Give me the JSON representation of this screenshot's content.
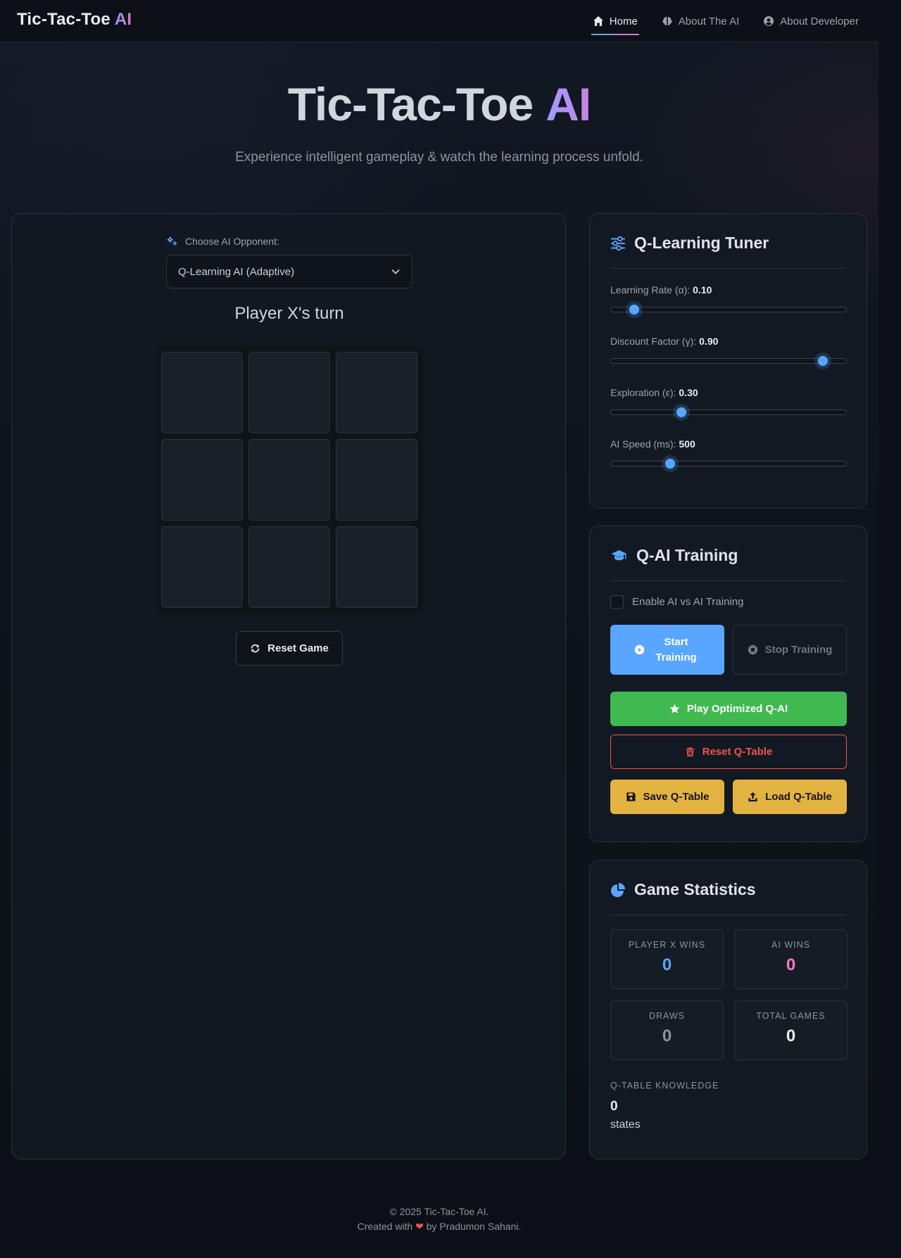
{
  "nav": {
    "brand_main": "Tic-Tac-Toe",
    "brand_accent": "AI",
    "links": [
      {
        "label": "Home",
        "icon": "home-icon",
        "active": true
      },
      {
        "label": "About The AI",
        "icon": "brain-icon",
        "active": false
      },
      {
        "label": "About Developer",
        "icon": "user-circle-icon",
        "active": false
      }
    ]
  },
  "hero": {
    "title_main": "Tic-Tac-Toe",
    "title_accent": "AI",
    "subtitle": "Experience intelligent gameplay & watch the learning process unfold."
  },
  "game": {
    "select_label": "Choose AI Opponent:",
    "select_value": "Q-Learning AI (Adaptive)",
    "turn_text": "Player X's turn",
    "board": [
      "",
      "",
      "",
      "",
      "",
      "",
      "",
      "",
      ""
    ],
    "reset_label": "Reset Game"
  },
  "tuner": {
    "title": "Q-Learning Tuner",
    "sliders": [
      {
        "label": "Learning Rate (α):",
        "value": "0.10",
        "fraction": 0.1
      },
      {
        "label": "Discount Factor (γ):",
        "value": "0.90",
        "fraction": 0.9
      },
      {
        "label": "Exploration (ε):",
        "value": "0.30",
        "fraction": 0.3
      },
      {
        "label": "AI Speed (ms):",
        "value": "500",
        "fraction": 0.25
      }
    ]
  },
  "training": {
    "title": "Q-AI Training",
    "checkbox_label": "Enable AI vs AI Training",
    "start_label": "Start Training",
    "stop_label": "Stop Training",
    "play_label": "Play Optimized Q-AI",
    "reset_q_label": "Reset Q-Table",
    "save_label": "Save Q-Table",
    "load_label": "Load Q-Table"
  },
  "stats": {
    "title": "Game Statistics",
    "player_x_label": "PLAYER X WINS",
    "player_x_value": "0",
    "ai_label": "AI WINS",
    "ai_value": "0",
    "draws_label": "DRAWS",
    "draws_value": "0",
    "total_label": "TOTAL GAMES",
    "total_value": "0",
    "qtable_label": "Q-TABLE KNOWLEDGE",
    "qtable_value": "0",
    "qtable_unit": "states"
  },
  "footer": {
    "line1": "© 2025 Tic-Tac-Toe AI.",
    "line2_prefix": "Created with",
    "line2_suffix": "by Pradumon Sahani."
  },
  "colors": {
    "accent_blue": "#58a6ff",
    "accent_pink": "#f778ba",
    "success_green": "#3fb950",
    "danger_red": "#f0524f",
    "warning_yellow": "#e3b341"
  }
}
